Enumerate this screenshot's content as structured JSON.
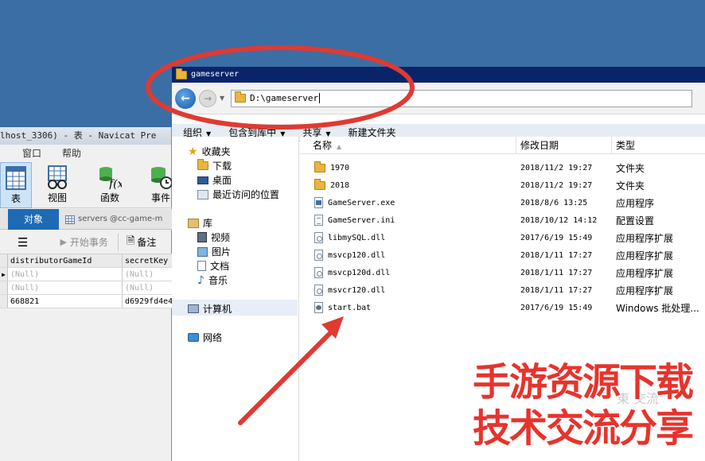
{
  "navicat": {
    "title": "lhost_3306) - 表 - Navicat Pre",
    "menu": [
      "窗口",
      "帮助"
    ],
    "tools": [
      {
        "label": "表",
        "icon": "table-icon"
      },
      {
        "label": "视图",
        "icon": "view-icon"
      },
      {
        "label": "函数",
        "icon": "function-icon"
      },
      {
        "label": "事件",
        "icon": "event-icon"
      }
    ],
    "tab_objects": "对象",
    "tab_servers": "servers @cc-game-m",
    "actions": {
      "begin_transaction": "开始事务",
      "memo": "备注"
    },
    "grid": {
      "columns": [
        "distributorGameId",
        "secretKey"
      ],
      "rows": [
        [
          "(Null)",
          "(Null)"
        ],
        [
          "(Null)",
          "(Null)"
        ],
        [
          "668821",
          "d6929fd4e4"
        ]
      ]
    }
  },
  "explorer": {
    "title": "gameserver",
    "address": "D:\\gameserver",
    "commands": [
      "组织",
      "包含到库中",
      "共享",
      "新建文件夹"
    ],
    "nav": {
      "favorites": "收藏夹",
      "favorites_items": [
        "下载",
        "桌面",
        "最近访问的位置"
      ],
      "libraries": "库",
      "library_items": [
        "视频",
        "图片",
        "文档",
        "音乐"
      ],
      "computer": "计算机",
      "network": "网络"
    },
    "columns": {
      "name": "名称",
      "date": "修改日期",
      "type": "类型"
    },
    "files": [
      {
        "name": "1970",
        "date": "2018/11/2 19:27",
        "type": "文件夹",
        "icon": "folder"
      },
      {
        "name": "2018",
        "date": "2018/11/2 19:27",
        "type": "文件夹",
        "icon": "folder"
      },
      {
        "name": "GameServer.exe",
        "date": "2018/8/6 13:25",
        "type": "应用程序",
        "icon": "exe"
      },
      {
        "name": "GameServer.ini",
        "date": "2018/10/12 14:12",
        "type": "配置设置",
        "icon": "ini"
      },
      {
        "name": "libmySQL.dll",
        "date": "2017/6/19 15:49",
        "type": "应用程序扩展",
        "icon": "dll"
      },
      {
        "name": "msvcp120.dll",
        "date": "2018/1/11 17:27",
        "type": "应用程序扩展",
        "icon": "dll"
      },
      {
        "name": "msvcp120d.dll",
        "date": "2018/1/11 17:27",
        "type": "应用程序扩展",
        "icon": "dll"
      },
      {
        "name": "msvcr120.dll",
        "date": "2018/1/11 17:27",
        "type": "应用程序扩展",
        "icon": "dll"
      },
      {
        "name": "start.bat",
        "date": "2017/6/19 15:49",
        "type": "Windows 批处理...",
        "icon": "bat"
      }
    ]
  },
  "watermark": {
    "line1": "手游资源下载",
    "line2": "技术交流分享"
  },
  "colors": {
    "desktop": "#3a6ea5",
    "annotation_red": "#e7332c",
    "title_bar": "#0a246a",
    "navicat_tab": "#1e6ab5"
  }
}
